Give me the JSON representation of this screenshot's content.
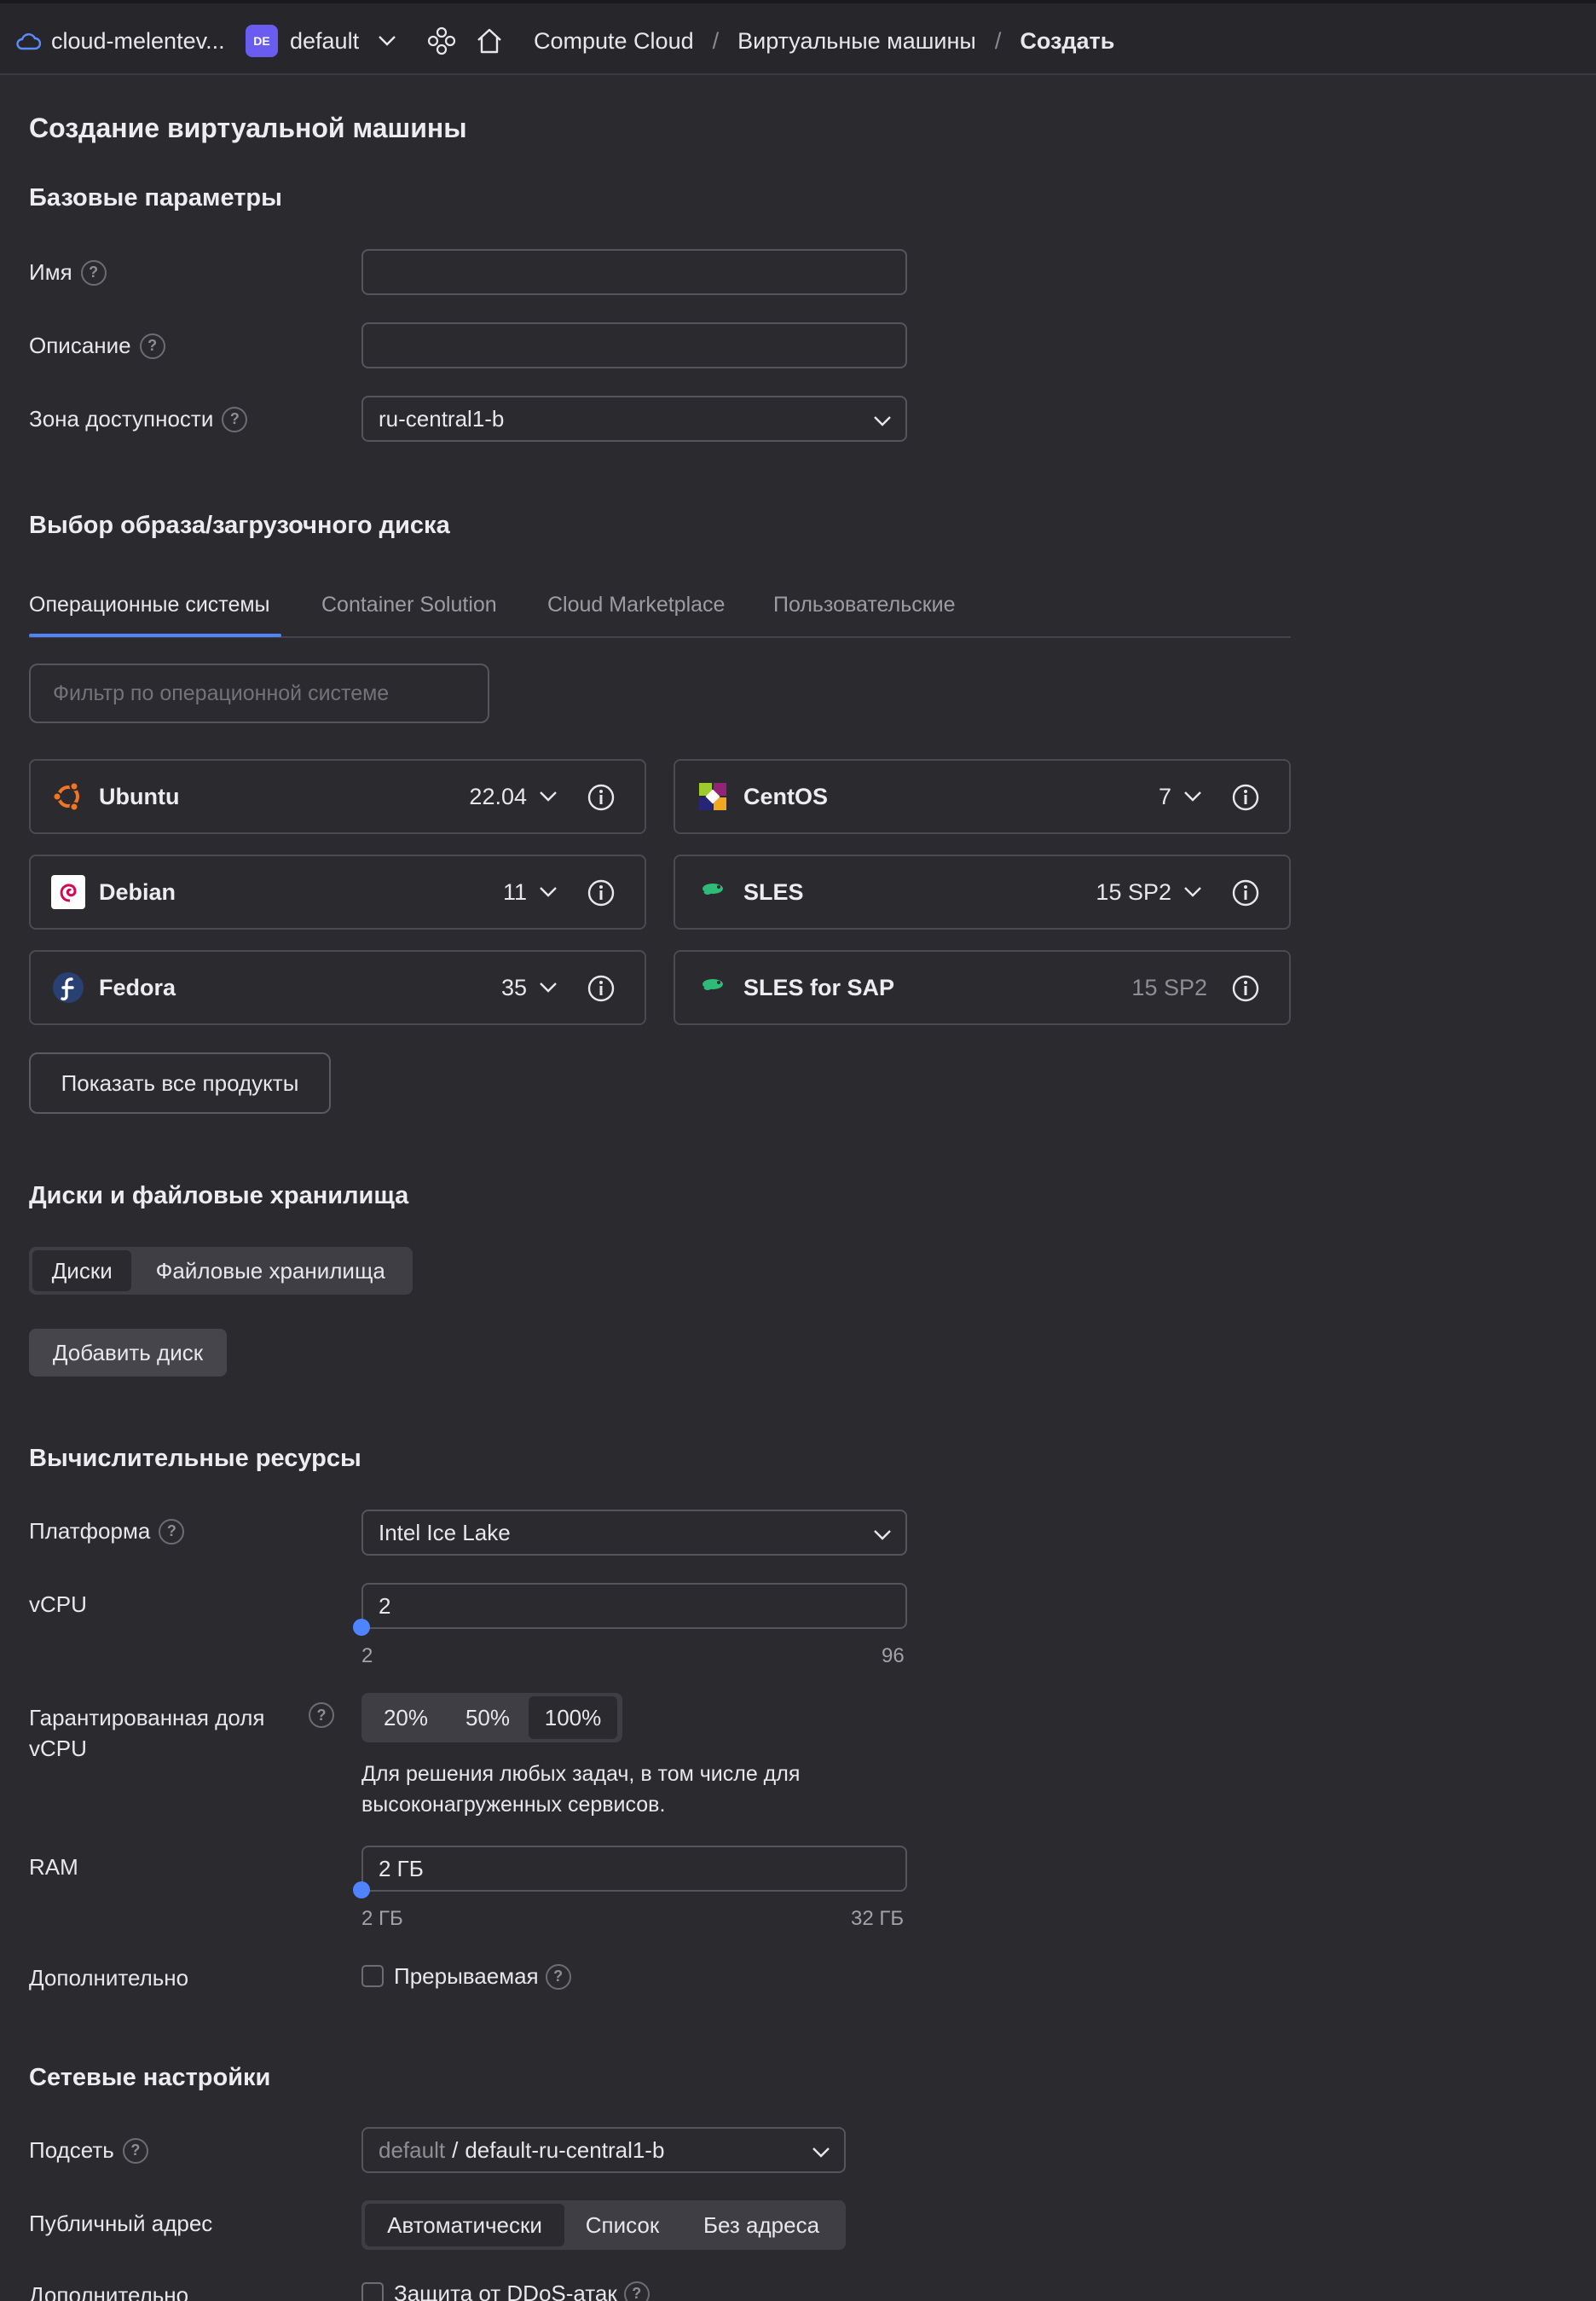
{
  "topbar": {
    "cloud": "cloud-melentev...",
    "folder_badge": "DE",
    "folder": "default",
    "breadcrumbs": [
      "Compute Cloud",
      "Виртуальные машины",
      "Создать"
    ],
    "separator": "/"
  },
  "page": {
    "title": "Создание виртуальной машины",
    "base_section": "Базовые параметры",
    "name_label": "Имя",
    "name_value": "",
    "description_label": "Описание",
    "description_value": "",
    "zone_label": "Зона доступности",
    "zone_value": "ru-central1-b"
  },
  "image": {
    "section": "Выбор образа/загрузочного диска",
    "tabs": [
      "Операционные системы",
      "Container Solution",
      "Cloud Marketplace",
      "Пользовательские"
    ],
    "filter_placeholder": "Фильтр по операционной системе",
    "os": [
      {
        "name": "Ubuntu",
        "version": "22.04"
      },
      {
        "name": "CentOS",
        "version": "7"
      },
      {
        "name": "Debian",
        "version": "11"
      },
      {
        "name": "SLES",
        "version": "15 SP2"
      },
      {
        "name": "Fedora",
        "version": "35"
      },
      {
        "name": "SLES for SAP",
        "version": "15 SP2"
      }
    ],
    "show_all": "Показать все продукты"
  },
  "disks": {
    "section": "Диски и файловые хранилища",
    "tabs": [
      "Диски",
      "Файловые хранилища"
    ],
    "add_disk": "Добавить диск"
  },
  "compute": {
    "section": "Вычислительные ресурсы",
    "platform_label": "Платформа",
    "platform_value": "Intel Ice Lake",
    "vcpu_label": "vCPU",
    "vcpu_value": "2",
    "vcpu_min": "2",
    "vcpu_max": "96",
    "share_label_1": "Гарантированная доля",
    "share_label_2": "vCPU",
    "share_options": [
      "20%",
      "50%",
      "100%"
    ],
    "share_selected": "100%",
    "share_note_1": "Для решения любых задач, в том числе для",
    "share_note_2": "высоконагруженных сервисов.",
    "ram_label": "RAM",
    "ram_value": "2 ГБ",
    "ram_min": "2 ГБ",
    "ram_max": "32 ГБ",
    "extra_label": "Дополнительно",
    "preemptible": "Прерываемая"
  },
  "network": {
    "section": "Сетевые настройки",
    "subnet_label": "Подсеть",
    "subnet_prefix": "default",
    "subnet_sep": "/",
    "subnet_value": "default-ru-central1-b",
    "public_label": "Публичный адрес",
    "public_options": [
      "Автоматически",
      "Список",
      "Без адреса"
    ],
    "public_selected": "Автоматически",
    "extra_label": "Дополнительно",
    "ddos": "Защита от DDoS-атак"
  },
  "colors": {
    "accent": "#4e84ff",
    "background": "#2a2a2f",
    "folder_badge": "#6a5cf0"
  }
}
